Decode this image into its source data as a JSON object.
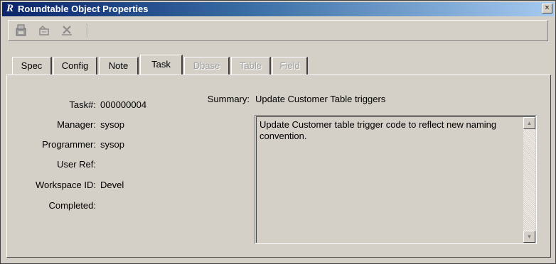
{
  "window": {
    "app_icon_letter": "R",
    "title": "Roundtable Object Properties",
    "close_glyph": "×"
  },
  "toolbar": {
    "buttons": [
      {
        "name": "save-icon"
      },
      {
        "name": "undo-icon"
      },
      {
        "name": "delete-icon"
      }
    ]
  },
  "tabs": [
    {
      "label": "Spec",
      "state": "normal"
    },
    {
      "label": "Config",
      "state": "normal"
    },
    {
      "label": "Note",
      "state": "normal"
    },
    {
      "label": "Task",
      "state": "active"
    },
    {
      "label": "Dbase",
      "state": "disabled"
    },
    {
      "label": "Table",
      "state": "disabled"
    },
    {
      "label": "Field",
      "state": "disabled"
    }
  ],
  "task": {
    "task_no_label": "Task#:",
    "task_no_value": "000000004",
    "manager_label": "Manager:",
    "manager_value": "sysop",
    "programmer_label": "Programmer:",
    "programmer_value": "sysop",
    "user_ref_label": "User Ref:",
    "user_ref_value": "",
    "workspace_label": "Workspace ID:",
    "workspace_value": "Devel",
    "completed_label": "Completed:",
    "completed_value": "",
    "summary_label": "Summary:",
    "summary_value": "Update Customer Table triggers",
    "description": "Update Customer table trigger code to reflect new naming convention."
  }
}
